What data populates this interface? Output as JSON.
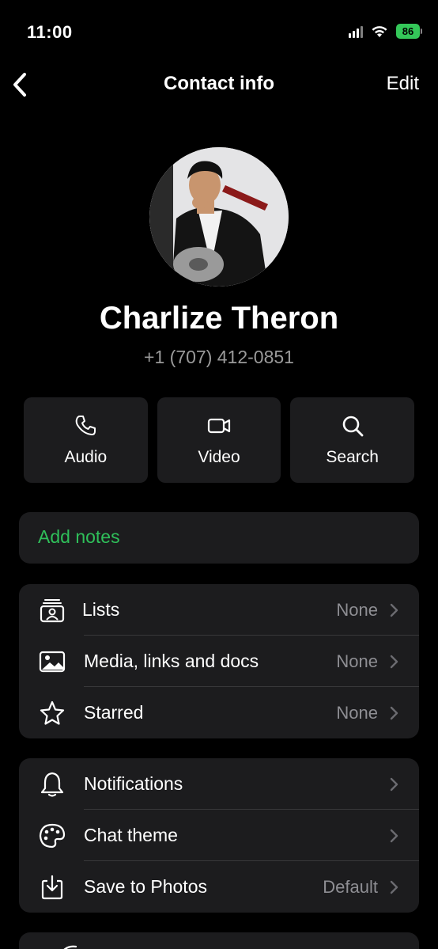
{
  "status": {
    "time": "11:00",
    "battery": "86"
  },
  "nav": {
    "title": "Contact info",
    "edit_label": "Edit"
  },
  "contact": {
    "name": "Charlize Theron",
    "phone": "+1 (707) 412-0851"
  },
  "actions": [
    {
      "label": "Audio",
      "icon": "phone-icon"
    },
    {
      "label": "Video",
      "icon": "video-icon"
    },
    {
      "label": "Search",
      "icon": "search-icon"
    }
  ],
  "notes": {
    "label": "Add notes",
    "color": "#2fbf5a"
  },
  "group1": [
    {
      "label": "Lists",
      "value": "None",
      "icon": "lists-icon"
    },
    {
      "label": "Media, links and docs",
      "value": "None",
      "icon": "image-icon"
    },
    {
      "label": "Starred",
      "value": "None",
      "icon": "star-icon"
    }
  ],
  "group2": [
    {
      "label": "Notifications",
      "value": "",
      "icon": "bell-icon"
    },
    {
      "label": "Chat theme",
      "value": "",
      "icon": "palette-icon"
    },
    {
      "label": "Save to Photos",
      "value": "Default",
      "icon": "save-download-icon"
    }
  ],
  "colors": {
    "background": "#000000",
    "card": "#1c1c1e",
    "accent_green": "#2fbf5a",
    "secondary_text": "#8e8e93"
  }
}
